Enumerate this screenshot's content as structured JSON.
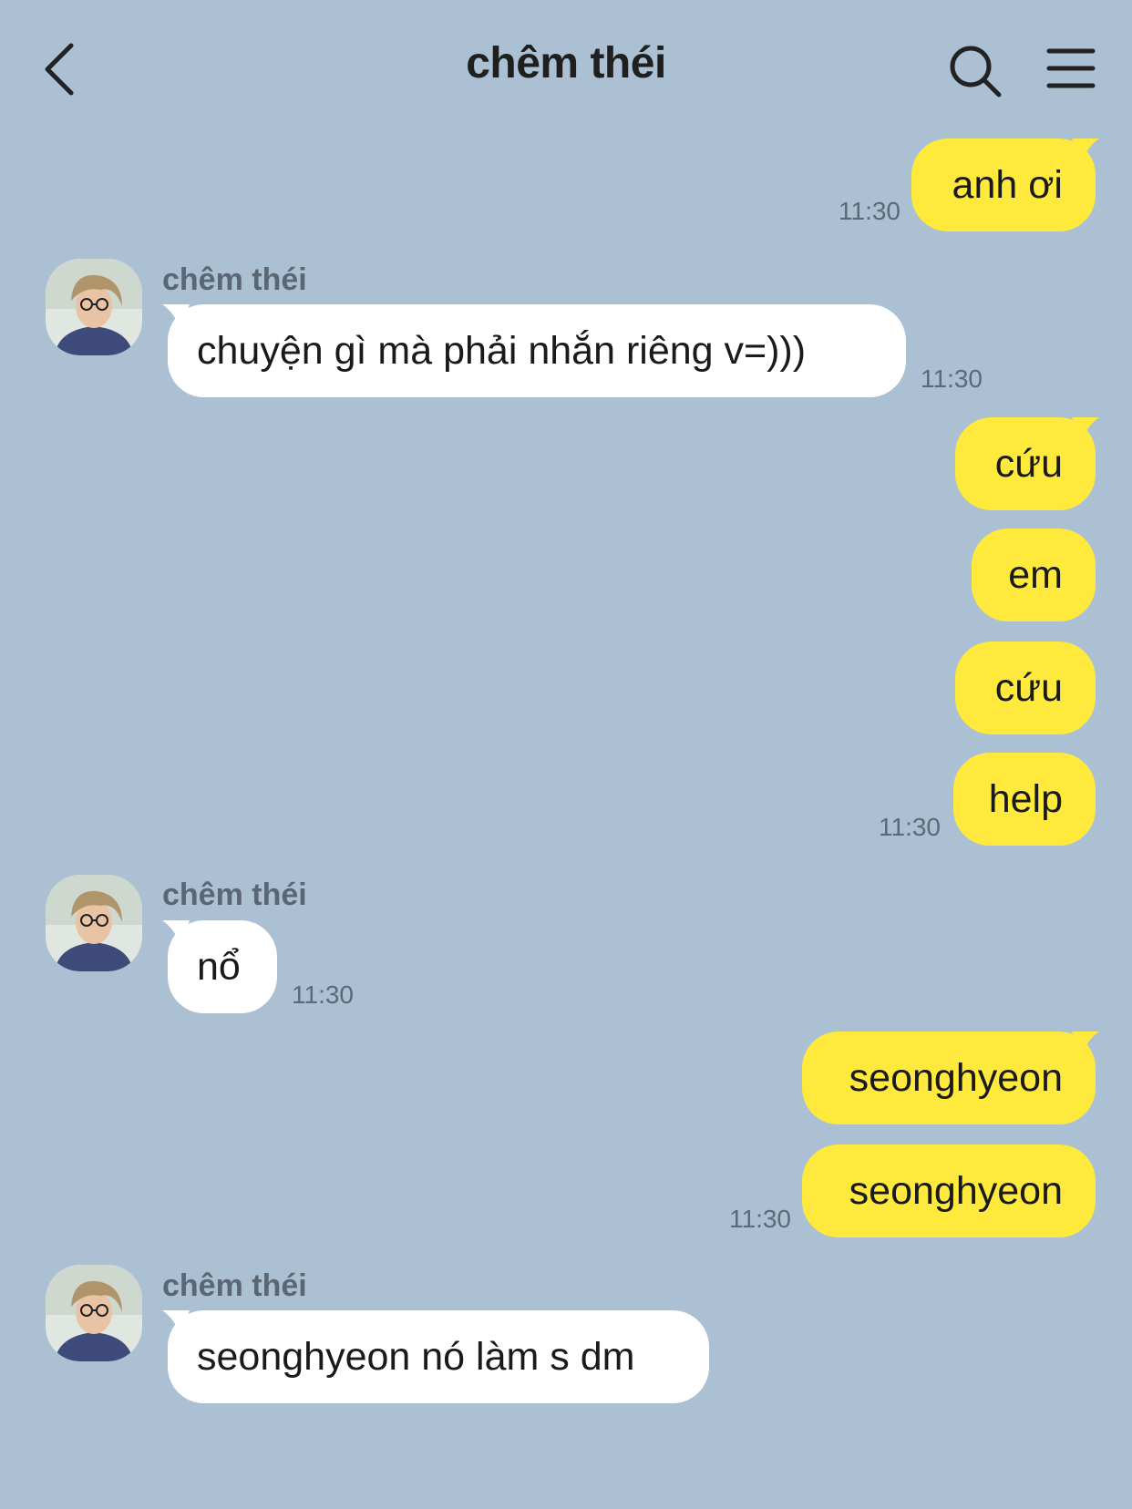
{
  "header": {
    "title": "chêm théi"
  },
  "messages": [
    {
      "dir": "out",
      "text": "anh ơi",
      "time": "11:30"
    },
    {
      "dir": "in",
      "sender": "chêm théi",
      "text": "chuyện gì mà phải nhắn riêng v=)))",
      "time": "11:30"
    },
    {
      "dir": "out",
      "text": "cứu"
    },
    {
      "dir": "out",
      "text": "em"
    },
    {
      "dir": "out",
      "text": "cứu"
    },
    {
      "dir": "out",
      "text": "help",
      "time": "11:30"
    },
    {
      "dir": "in",
      "sender": "chêm théi",
      "text": "nổ",
      "time": "11:30"
    },
    {
      "dir": "out",
      "text": "seonghyeon"
    },
    {
      "dir": "out",
      "text": "seonghyeon",
      "time": "11:30"
    },
    {
      "dir": "in",
      "sender": "chêm théi",
      "text": "seonghyeon nó làm s dm"
    }
  ],
  "colors": {
    "background": "#abc1d3",
    "outgoing_bubble": "#fee93c",
    "incoming_bubble": "#ffffff"
  },
  "icons": [
    "back-arrow-icon",
    "search-icon",
    "menu-icon"
  ]
}
